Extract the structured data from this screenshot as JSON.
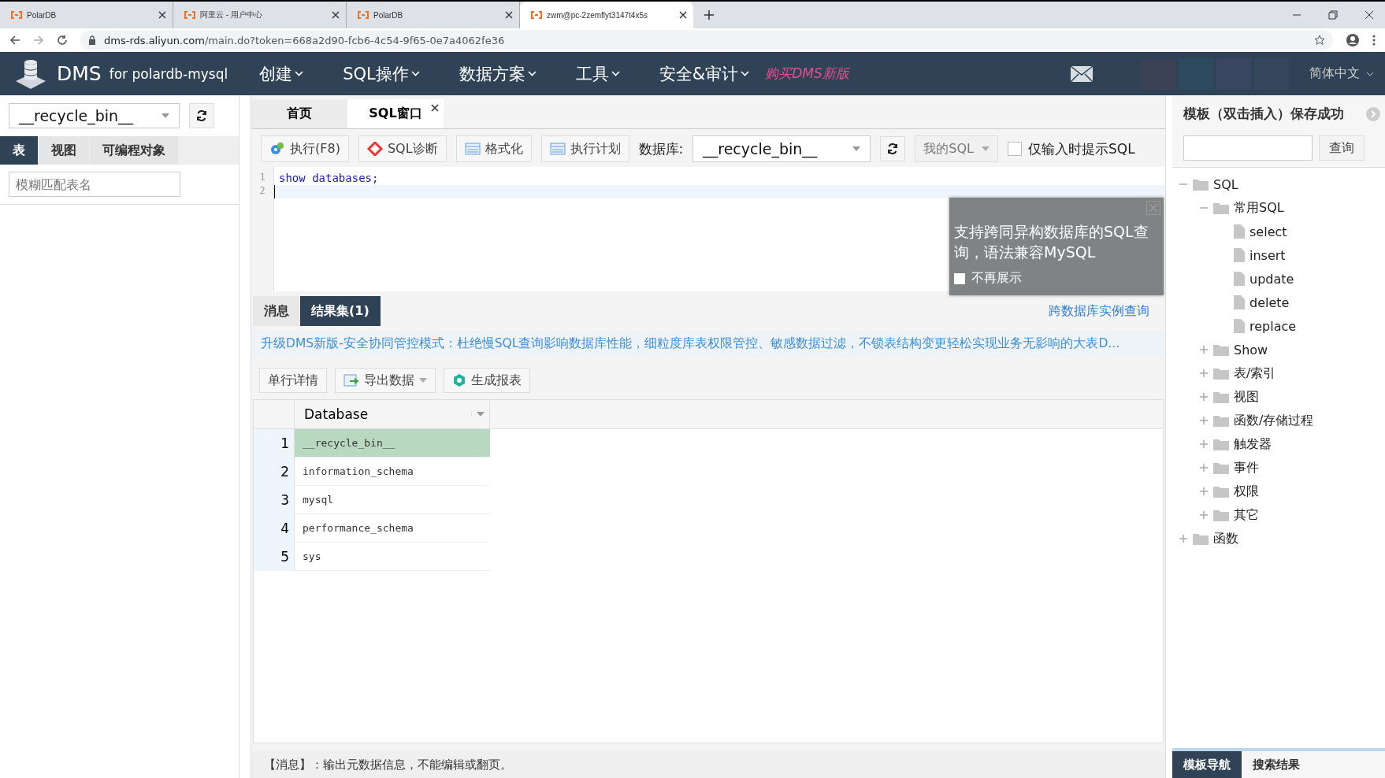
{
  "browser": {
    "tabs": [
      {
        "title": "PolarDB",
        "selected": false
      },
      {
        "title": "阿里云 - 用户中心",
        "selected": false
      },
      {
        "title": "PolarDB",
        "selected": false
      },
      {
        "title": "zwm@pc-2zemflyt3147t4x5s",
        "selected": true
      }
    ],
    "url_host": "dms-rds.aliyun.com",
    "url_path": "/main.do?token=668a2d90-fcb6-4c54-9f65-0e7a4062fe36"
  },
  "nav": {
    "brand": "DMS",
    "brand_sub": "for polardb-mysql",
    "menus": [
      "创建",
      "SQL操作",
      "数据方案",
      "工具",
      "安全&审计"
    ],
    "promo": "购买DMS新版",
    "language": "简体中文"
  },
  "left": {
    "database": "__recycle_bin__",
    "tabs": [
      {
        "label": "表",
        "selected": true
      },
      {
        "label": "视图",
        "selected": false
      },
      {
        "label": "可编程对象",
        "selected": false
      }
    ],
    "search": {
      "placeholder": "模糊匹配表名"
    }
  },
  "main_tabs": [
    {
      "label": "首页",
      "selected": false,
      "closable": false
    },
    {
      "label": "SQL窗口",
      "selected": true,
      "closable": true
    }
  ],
  "toolbar": {
    "buttons": [
      {
        "label": "执行(F8)",
        "kind": "run"
      },
      {
        "label": "SQL诊断",
        "kind": "diagnose"
      },
      {
        "label": "格式化",
        "kind": "format"
      },
      {
        "label": "执行计划",
        "kind": "plan"
      }
    ],
    "database_label": "数据库:",
    "database": "__recycle_bin__",
    "my_sql": "我的SQL",
    "hint_option": {
      "label": "仅输入时提示SQL",
      "checked": false
    }
  },
  "editor": {
    "lines": [
      {
        "number": "1",
        "code": "show databases;"
      },
      {
        "number": "2"
      }
    ]
  },
  "tooltip": {
    "text": "支持跨同异构数据库的SQL查询，语法兼容MySQL",
    "dont_show": {
      "label": "不再展示",
      "checked": false
    }
  },
  "result_tabs": [
    {
      "label": "消息",
      "selected": false
    },
    {
      "label": "结果集(1)",
      "selected": true
    }
  ],
  "cross_query_link": "跨数据库实例查询",
  "banner": "升级DMS新版-安全协同管控模式：杜绝慢SQL查询影响数据库性能，细粒度库表权限管控、敏感数据过滤，不锁表结构变更轻松实现业务无影响的大表D...",
  "result_buttons": [
    {
      "label": "单行详情",
      "kind": "plain"
    },
    {
      "label": "导出数据",
      "kind": "export"
    },
    {
      "label": "生成报表",
      "kind": "report"
    }
  ],
  "table": {
    "columns": [
      "Database"
    ],
    "rows": [
      {
        "number": "1",
        "cells": [
          "__recycle_bin__"
        ],
        "selected": true
      },
      {
        "number": "2",
        "cells": [
          "information_schema"
        ],
        "selected": false
      },
      {
        "number": "3",
        "cells": [
          "mysql"
        ],
        "selected": false
      },
      {
        "number": "4",
        "cells": [
          "performance_schema"
        ],
        "selected": false
      },
      {
        "number": "5",
        "cells": [
          "sys"
        ],
        "selected": false
      }
    ]
  },
  "status_message": "【消息】：输出元数据信息，不能编辑或翻页。",
  "right": {
    "title": "模板（双击插入）保存成功",
    "search_button": "查询",
    "tree": [
      {
        "label": "SQL",
        "kind": "folder",
        "expanded": true,
        "children": [
          {
            "label": "常用SQL",
            "kind": "folder",
            "expanded": true,
            "children": [
              {
                "label": "select",
                "kind": "file"
              },
              {
                "label": "insert",
                "kind": "file"
              },
              {
                "label": "update",
                "kind": "file"
              },
              {
                "label": "delete",
                "kind": "file"
              },
              {
                "label": "replace",
                "kind": "file"
              }
            ]
          },
          {
            "label": "Show",
            "kind": "folder",
            "expanded": false
          },
          {
            "label": "表/索引",
            "kind": "folder",
            "expanded": false
          },
          {
            "label": "视图",
            "kind": "folder",
            "expanded": false
          },
          {
            "label": "函数/存储过程",
            "kind": "folder",
            "expanded": false
          },
          {
            "label": "触发器",
            "kind": "folder",
            "expanded": false
          },
          {
            "label": "事件",
            "kind": "folder",
            "expanded": false
          },
          {
            "label": "权限",
            "kind": "folder",
            "expanded": false
          },
          {
            "label": "其它",
            "kind": "folder",
            "expanded": false
          }
        ]
      },
      {
        "label": "函数",
        "kind": "folder",
        "expanded": false
      }
    ],
    "bottom_tabs": [
      {
        "label": "模板导航",
        "selected": true
      },
      {
        "label": "搜索结果",
        "selected": false
      }
    ]
  }
}
